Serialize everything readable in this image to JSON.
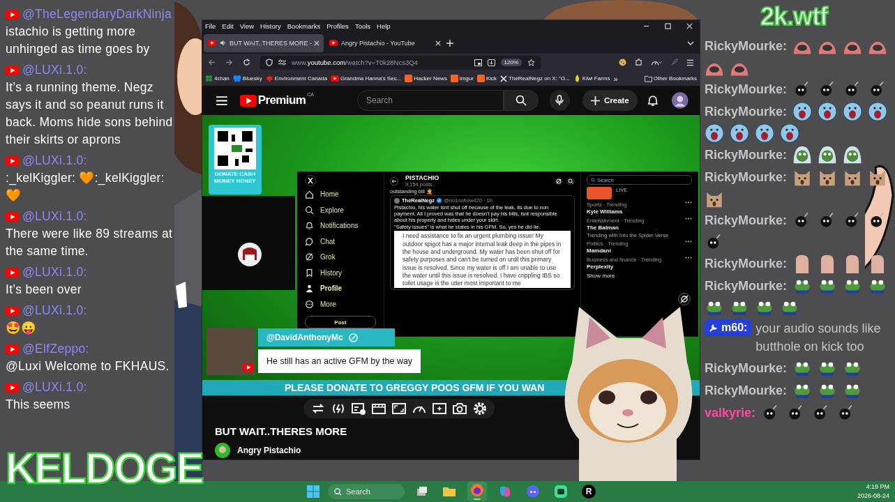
{
  "left_chat": [
    {
      "author": "@TheLegendaryDarkNinja",
      "text": "istachio is getting more unhinged as time goes by"
    },
    {
      "author": "@LUXi.1.0:",
      "text": "It’s a running theme. Negz says it and so peanut runs it back. Moms hide sons behind their skirts or aprons"
    },
    {
      "author": "@LUXi.1.0:",
      "text": ":_kelKiggler: 🧡:_kelKiggler:🧡"
    },
    {
      "author": "@LUXi.1.0:",
      "text": "There were like 89 streams at the same time."
    },
    {
      "author": "@LUXi.1.0:",
      "text": "It’s been over"
    },
    {
      "author": "@LUXi.1.0:",
      "text": "🤩😛"
    },
    {
      "author": "@ElfZeppo:",
      "text": "@Luxi Welcome to FKHAUS."
    },
    {
      "author": "@LUXi.1.0:",
      "text": "This seems"
    }
  ],
  "right_chat": [
    {
      "kind": "emotes",
      "author": "RickyMourke:",
      "emotes": [
        {
          "kind": "dome"
        },
        {
          "kind": "dome"
        },
        {
          "kind": "dome"
        },
        {
          "kind": "dome"
        },
        {
          "kind": "dome"
        },
        {
          "kind": "dome"
        }
      ]
    },
    {
      "kind": "emotes",
      "author": "RickyMourke:",
      "emotes": [
        {
          "kind": "bomb"
        },
        {
          "kind": "bomb"
        },
        {
          "kind": "bomb"
        },
        {
          "kind": "bomb"
        }
      ]
    },
    {
      "kind": "emotes",
      "author": "RickyMourke:",
      "emotes": [
        {
          "kind": "scream"
        },
        {
          "kind": "scream"
        },
        {
          "kind": "scream"
        },
        {
          "kind": "scream"
        },
        {
          "kind": "scream"
        },
        {
          "kind": "scream"
        },
        {
          "kind": "scream"
        },
        {
          "kind": "scream"
        }
      ]
    },
    {
      "kind": "emotes",
      "author": "RickyMourke:",
      "emotes": [
        {
          "kind": "hood"
        },
        {
          "kind": "hood"
        },
        {
          "kind": "hood"
        }
      ]
    },
    {
      "kind": "emotes",
      "author": "RickyMourke:",
      "emotes": [
        {
          "kind": "cat"
        },
        {
          "kind": "cat"
        },
        {
          "kind": "cat"
        },
        {
          "kind": "cat"
        },
        {
          "kind": "cat"
        }
      ]
    },
    {
      "kind": "emotes",
      "author": "RickyMourke:",
      "emotes": [
        {
          "kind": "bomb"
        },
        {
          "kind": "bomb"
        },
        {
          "kind": "bomb"
        },
        {
          "kind": "bomb"
        },
        {
          "kind": "bomb"
        }
      ]
    },
    {
      "kind": "emotes",
      "author": "RickyMourke:",
      "emotes": [
        {
          "kind": "thumb"
        },
        {
          "kind": "thumb"
        },
        {
          "kind": "thumb"
        },
        {
          "kind": "thumb"
        }
      ]
    },
    {
      "kind": "emotes",
      "author": "RickyMourke:",
      "emotes": [
        {
          "kind": "frog"
        },
        {
          "kind": "frog"
        },
        {
          "kind": "frog"
        },
        {
          "kind": "frog"
        },
        {
          "kind": "frog"
        },
        {
          "kind": "frog"
        },
        {
          "kind": "frog"
        },
        {
          "kind": "frog"
        }
      ]
    },
    {
      "kind": "message",
      "author": "m60:",
      "text": "your audio sounds like butthole on kick too"
    },
    {
      "kind": "emotes",
      "author": "RickyMourke:",
      "emotes": [
        {
          "kind": "frog"
        },
        {
          "kind": "frog"
        },
        {
          "kind": "frog"
        }
      ]
    },
    {
      "kind": "emotes",
      "author": "RickyMourke:",
      "emotes": [
        {
          "kind": "frog"
        },
        {
          "kind": "frog"
        },
        {
          "kind": "frog"
        }
      ]
    },
    {
      "kind": "emotes",
      "author": "valkyrie:",
      "emotes": [
        {
          "kind": "bomb"
        },
        {
          "kind": "bomb"
        },
        {
          "kind": "bomb"
        },
        {
          "kind": "bomb"
        }
      ]
    }
  ],
  "overlays": {
    "site_tag": "2k.wtf",
    "streamer_name": "KELDOGE"
  },
  "browser": {
    "menu": [
      "File",
      "Edit",
      "View",
      "History",
      "Bookmarks",
      "Profiles",
      "Tools",
      "Help"
    ],
    "tabs": [
      {
        "title": "BUT WAIT..THERES MORE -",
        "selected": true,
        "audio": true
      },
      {
        "title": "Angry Pistachio - YouTube",
        "selected": false,
        "audio": false
      }
    ],
    "url": "www.**youtube.com**/watch?v=T0k28Ncs3Q4",
    "zoom": "120%",
    "bookmarks": [
      {
        "kind": "clover",
        "label": "4chan"
      },
      {
        "kind": "butterfly",
        "label": "Bluesky"
      },
      {
        "kind": "leaf",
        "label": "Environment Canada"
      },
      {
        "kind": "play",
        "label": "Grandma Hanna's Sec..."
      },
      {
        "kind": "tile",
        "label": "Hacker News"
      },
      {
        "kind": "tile",
        "label": "imgur"
      },
      {
        "kind": "tile",
        "label": "Kick"
      },
      {
        "kind": "cross",
        "label": "TheRealNegz on X: \"G..."
      },
      {
        "kind": "drop",
        "label": "Kiwi Farms"
      }
    ],
    "bookmarks_overflow": "»",
    "other_bookmarks": "Other Bookmarks"
  },
  "youtube": {
    "logo": "Premium",
    "region": "CA",
    "search_placeholder": "Search",
    "create": "Create",
    "video": {
      "donate": "DONATE CASH MONEY HONEY",
      "comment_author": "@DavidAnthonyMc",
      "comment": "He still has an active GFM by the way",
      "ticker": "PLEASE DONATE TO GREGGY POOS GFM IF YOU WAN",
      "x_post": {
        "nav": [
          {
            "label": "Home",
            "kind": "home",
            "selected": false
          },
          {
            "label": "Explore",
            "kind": "search",
            "selected": false
          },
          {
            "label": "Notifications",
            "kind": "bell",
            "selected": false
          },
          {
            "label": "Chat",
            "kind": "chat",
            "selected": false
          },
          {
            "label": "Grok",
            "kind": "grok",
            "selected": false
          },
          {
            "label": "History",
            "kind": "bookmark",
            "selected": false
          },
          {
            "label": "Profile",
            "kind": "person",
            "selected": true
          },
          {
            "label": "More",
            "kind": "more",
            "selected": false
          }
        ],
        "post_button": "Post",
        "profile_name": "PISTACHIO",
        "post_count": "9,154 posts",
        "reply_tail": "outstanding bill 🤦",
        "quote_author": "TheRealNegz",
        "quote_handle": "@no1nohow420 · 1h",
        "quote_text": "Pistachio, his water isnt shut off because of the leak, its due to non payment. All I proved was that he doesn't pay his bills, isnt responsible about his property and hides under your skirt.",
        "quote_text_2": "\"Safety issues\" is what he states in his GFM. So, yes he did lie.",
        "gfm_text": "I need assistance to fix an urgent plumbing issue! My outdoor spigot has a major internal leak deep in the pipes in the house and underground. My water has been shut off for safety purposes and can't be turned on until this primary issue is resolved. Since my water is off I am unable to use the water until this issue is resolved. I have crippling IBS so toilet usage is the utter most important to me",
        "search_placeholder": "Search",
        "live": "LIVE",
        "trends": [
          {
            "context": "Sports · Trending",
            "topic": "Kyle Williams"
          },
          {
            "context": "Entertainment · Trending",
            "topic": "The Batman",
            "note": "Trending with Into the Spider-Verse"
          },
          {
            "context": "Politics · Trending",
            "topic": "Mamdani"
          },
          {
            "context": "Business and finance · Trending",
            "topic": "Perplexity"
          }
        ],
        "show_more": "Show more"
      }
    },
    "controls": [
      {
        "kind": "loop"
      },
      {
        "kind": "live"
      },
      {
        "kind": "subtitles"
      },
      {
        "kind": "film"
      },
      {
        "kind": "aspect"
      },
      {
        "kind": "speed"
      },
      {
        "kind": "sparkle"
      },
      {
        "kind": "camera"
      },
      {
        "kind": "gear"
      }
    ],
    "title": "BUT WAIT..THERES MORE",
    "channel": "Angry Pistachio"
  },
  "taskbar": {
    "search_placeholder": "Search",
    "apps": [
      {
        "kind": "taskview",
        "active": false
      },
      {
        "kind": "folder",
        "active": false
      },
      {
        "kind": "firefox",
        "active": true
      },
      {
        "kind": "copilot",
        "active": false
      },
      {
        "kind": "discord",
        "active": false
      },
      {
        "kind": "app",
        "active": false
      },
      {
        "kind": "letter",
        "label": "R",
        "active": false
      }
    ],
    "time": "4:19 PM",
    "date": "2026-08-24"
  }
}
